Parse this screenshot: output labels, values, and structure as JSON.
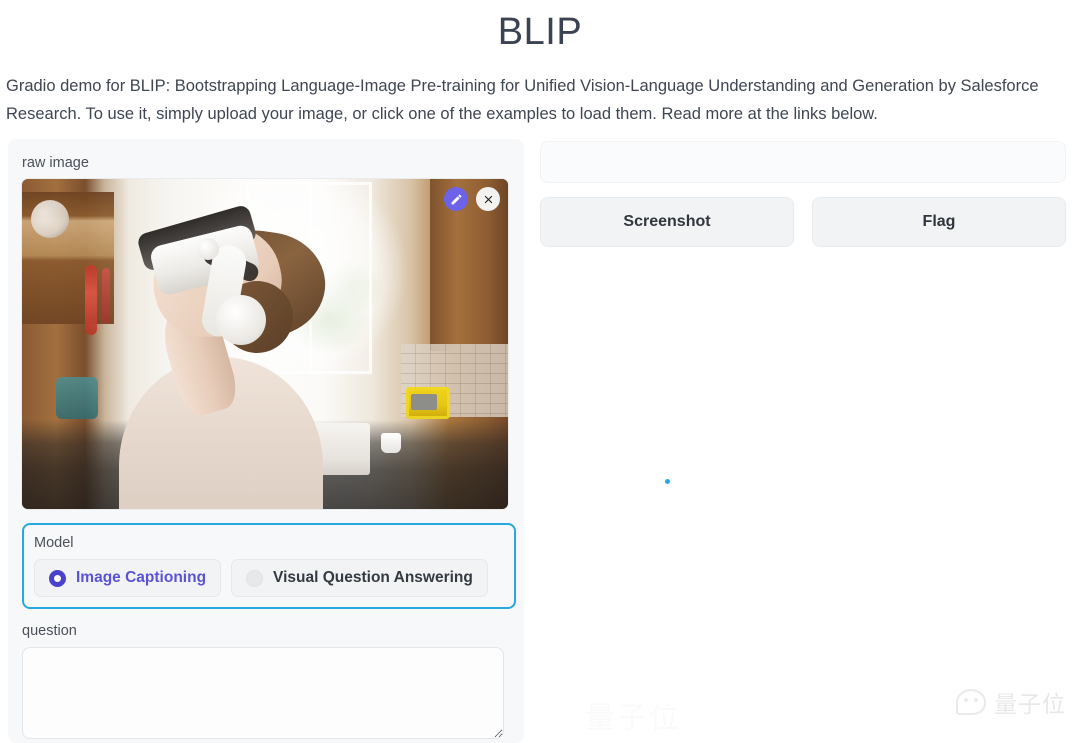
{
  "header": {
    "title": "BLIP",
    "description": "Gradio demo for BLIP: Bootstrapping Language-Image Pre-training for Unified Vision-Language Understanding and Generation by Salesforce Research. To use it, simply upload your image, or click one of the examples to load them. Read more at the links below."
  },
  "left_panel": {
    "image_label": "raw image",
    "image_alt": "Woman wearing a white VR headset looking upward in a bright kitchen with a window, wooden cabinets, a yellow toaster and a white sink",
    "image_actions": {
      "edit_icon": "pencil-edit-icon",
      "clear_icon": "close-x-icon"
    },
    "model_group": {
      "label": "Model",
      "options": [
        {
          "label": "Image Captioning",
          "selected": true
        },
        {
          "label": "Visual Question Answering",
          "selected": false
        }
      ]
    },
    "question": {
      "label": "question",
      "value": "",
      "placeholder": ""
    }
  },
  "right_panel": {
    "output": {
      "value": ""
    },
    "buttons": [
      {
        "label": "Screenshot"
      },
      {
        "label": "Flag"
      }
    ],
    "loading_indicator": "loading-dot"
  },
  "watermarks": {
    "logo_text": "量子位",
    "faint_text": "量子位"
  },
  "colors": {
    "accent_focus": "#26a9dd",
    "radio_selected": "#4a43c9",
    "radio_selected_text": "#5b53d6",
    "edit_button": "#6c63e8",
    "loading_dot": "#2aa8e0",
    "panel_background": "#f7f8f9",
    "button_background": "#f1f3f5",
    "text_primary": "#3f4652"
  }
}
